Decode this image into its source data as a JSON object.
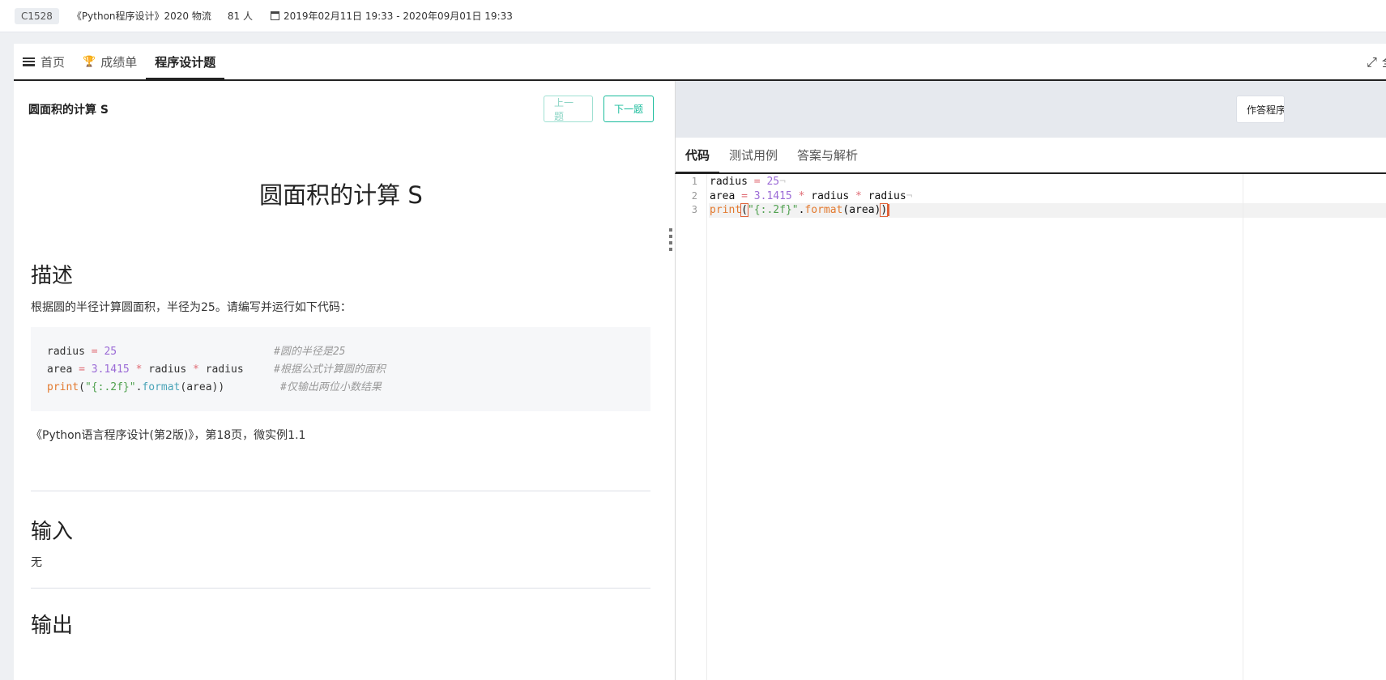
{
  "topbar": {
    "course_code": "C1528",
    "course_name": "《Python程序设计》2020 物流",
    "members": "81 人",
    "date_range": "2019年02月11日 19:33 - 2020年09月01日 19:33"
  },
  "tabs": [
    {
      "label": "首页",
      "icon": "home-list-icon"
    },
    {
      "label": "成绩单",
      "icon": "trophy-icon"
    },
    {
      "label": "程序设计题",
      "icon": ""
    }
  ],
  "fullscreen_label": "全",
  "problem": {
    "header": "圆面积的计算 S",
    "prev_label": "上一题",
    "next_label": "下一题",
    "title": "圆面积的计算 S",
    "desc_heading": "描述",
    "desc_text": "根据圆的半径计算圆面积，半径为25。请编写并运行如下代码：",
    "sample_code": [
      {
        "code": "radius = 25",
        "comment": "#圆的半径是25"
      },
      {
        "code": "area = 3.1415 * radius * radius",
        "comment": "#根据公式计算圆的面积"
      },
      {
        "code": "print(\"{:.2f}\".format(area))",
        "comment": "#仅输出两位小数结果"
      }
    ],
    "source_text": "《Python语言程序设计(第2版)》，第18页，微实例1.1",
    "input_heading": "输入",
    "input_text": "无",
    "output_heading": "输出"
  },
  "editor": {
    "answer_button": "作答程序",
    "tabs": [
      "代码",
      "测试用例",
      "答案与解析"
    ],
    "line_numbers": [
      "1",
      "2",
      "3"
    ],
    "lines": [
      "radius = 25",
      "area = 3.1415 * radius * radius",
      "print(\"{:.2f}\".format(area))"
    ]
  },
  "colors": {
    "accent": "#1abc9c",
    "code_operator": "#e06c75",
    "code_number": "#9b6bd6",
    "code_keyword": "#e37a2f",
    "code_string": "#50a14f",
    "cursor": "#e0633a"
  }
}
